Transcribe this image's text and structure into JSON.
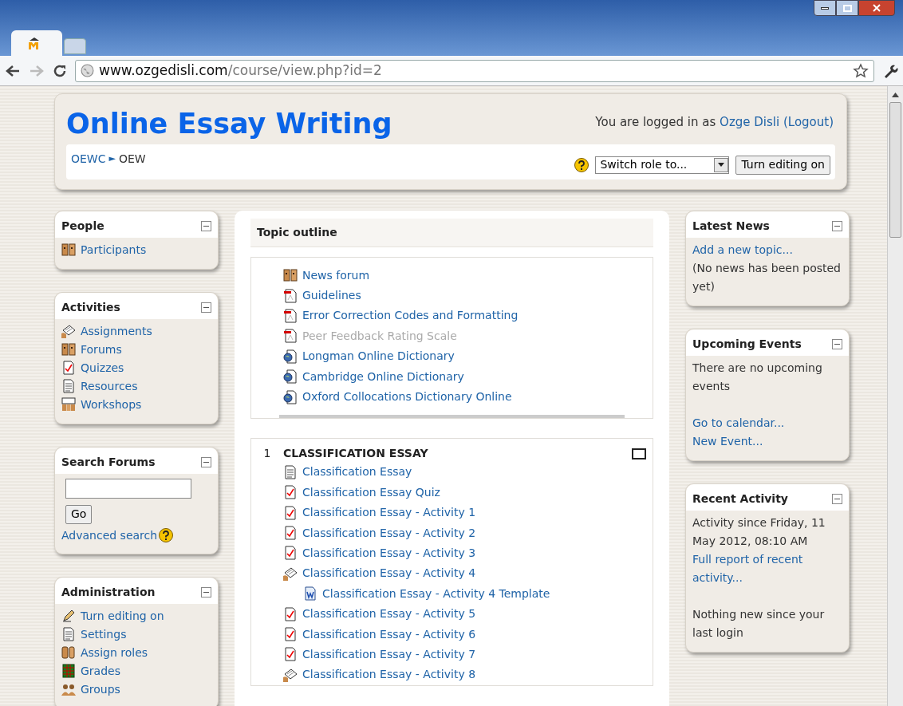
{
  "browser": {
    "url_host": "www.ozgedisli.com",
    "url_path": "/course/view.php?id=2"
  },
  "header": {
    "title": "Online Essay Writing",
    "login_text": "You are logged in as",
    "user": "Ozge Disli",
    "logout": "(Logout)",
    "breadcrumb": [
      "OEWC",
      "OEW"
    ],
    "breadcrumb_separator": "►",
    "role_select": "Switch role to...",
    "editing_button": "Turn editing on"
  },
  "left_blocks": [
    {
      "kind": "links",
      "title": "People",
      "items": [
        {
          "label": "Participants",
          "kind": "people"
        }
      ]
    },
    {
      "kind": "links",
      "title": "Activities",
      "items": [
        {
          "label": "Assignments",
          "kind": "assignment"
        },
        {
          "label": "Forums",
          "kind": "people"
        },
        {
          "label": "Quizzes",
          "kind": "quiz"
        },
        {
          "label": "Resources",
          "kind": "resource"
        },
        {
          "label": "Workshops",
          "kind": "workshop"
        }
      ]
    },
    {
      "kind": "search",
      "title": "Search Forums",
      "button": "Go",
      "link": "Advanced search"
    },
    {
      "kind": "links",
      "title": "Administration",
      "items": [
        {
          "label": "Turn editing on",
          "kind": "edit"
        },
        {
          "label": "Settings",
          "kind": "resource"
        },
        {
          "label": "Assign roles",
          "kind": "roles"
        },
        {
          "label": "Grades",
          "kind": "grades"
        },
        {
          "label": "Groups",
          "kind": "groups"
        }
      ]
    }
  ],
  "topic_outline": {
    "title": "Topic outline",
    "items": [
      {
        "label": "News forum",
        "kind": "people",
        "dimmed": false
      },
      {
        "label": "Guidelines",
        "kind": "pdf",
        "dimmed": false
      },
      {
        "label": "Error Correction Codes and Formatting",
        "kind": "pdf",
        "dimmed": false
      },
      {
        "label": "Peer Feedback Rating Scale",
        "kind": "pdf",
        "dimmed": true
      },
      {
        "label": "Longman Online Dictionary",
        "kind": "web",
        "dimmed": false
      },
      {
        "label": "Cambridge Online Dictionary",
        "kind": "web",
        "dimmed": false
      },
      {
        "label": "Oxford Collocations Dictionary Online",
        "kind": "web",
        "dimmed": false
      }
    ]
  },
  "sections": [
    {
      "number": "1",
      "title": "CLASSIFICATION ESSAY",
      "items": [
        {
          "label": "Classification Essay",
          "kind": "resource",
          "dimmed": false
        },
        {
          "label": "Classification Essay Quiz",
          "kind": "quiz",
          "dimmed": false
        },
        {
          "label": "Classification Essay - Activity 1",
          "kind": "quiz",
          "dimmed": false
        },
        {
          "label": "Classification Essay - Activity 2",
          "kind": "quiz",
          "dimmed": false
        },
        {
          "label": "Classification Essay - Activity 3",
          "kind": "quiz",
          "dimmed": false
        },
        {
          "label": "Classification Essay - Activity 4",
          "kind": "assignment",
          "dimmed": false,
          "children": [
            {
              "label": "Classification Essay - Activity 4 Template",
              "kind": "word",
              "dimmed": false
            }
          ]
        },
        {
          "label": "Classification Essay - Activity 5",
          "kind": "quiz",
          "dimmed": false
        },
        {
          "label": "Classification Essay - Activity 6",
          "kind": "quiz",
          "dimmed": false
        },
        {
          "label": "Classification Essay - Activity 7",
          "kind": "quiz",
          "dimmed": false
        },
        {
          "label": "Classification Essay - Activity 8",
          "kind": "assignment",
          "dimmed": false
        }
      ]
    }
  ],
  "right_blocks": [
    {
      "title": "Latest News",
      "groups": [
        [
          {
            "kind": "link",
            "text": "Add a new topic..."
          },
          {
            "kind": "text",
            "text": "(No news has been posted yet)"
          }
        ]
      ]
    },
    {
      "title": "Upcoming Events",
      "groups": [
        [
          {
            "kind": "text",
            "text": "There are no upcoming events"
          }
        ],
        [
          {
            "kind": "link",
            "text": "Go to calendar..."
          },
          {
            "kind": "link",
            "text": "New Event..."
          }
        ]
      ]
    },
    {
      "title": "Recent Activity",
      "groups": [
        [
          {
            "kind": "text",
            "text": "Activity since Friday, 11 May 2012, 08:10 AM"
          },
          {
            "kind": "link",
            "text": "Full report of recent activity..."
          }
        ],
        [
          {
            "kind": "text",
            "text": "Nothing new since your last login"
          }
        ]
      ]
    }
  ]
}
